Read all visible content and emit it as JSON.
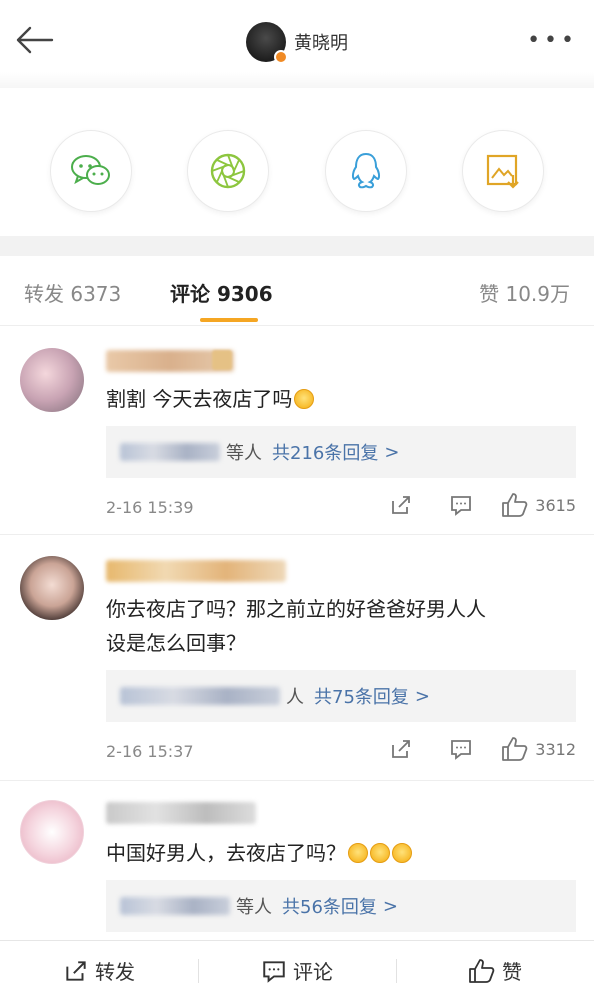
{
  "header": {
    "title": "黄晓明",
    "more_label": "•••"
  },
  "share": {
    "items": [
      {
        "icon": "wechat-icon"
      },
      {
        "icon": "moments-icon"
      },
      {
        "icon": "qq-icon"
      },
      {
        "icon": "save-image-icon"
      }
    ]
  },
  "tabs": {
    "repost": "转发 6373",
    "comment": "评论 9306",
    "like": "赞 10.9万"
  },
  "comments": [
    {
      "text": "割割 今天去夜店了吗",
      "replies_who": "等人",
      "replies_count": "共216条回复",
      "arrow": ">",
      "time": "2-16 15:39",
      "likes": "3615"
    },
    {
      "text_line1": "你去夜店了吗？那之前立的好爸爸好男人人",
      "text_line2": "设是怎么回事？",
      "replies_who": "人",
      "replies_count": "共75条回复",
      "arrow": ">",
      "time": "2-16 15:37",
      "likes": "3312"
    },
    {
      "text": "中国好男人，去夜店了吗？",
      "replies_who": "等人",
      "replies_count": "共56条回复",
      "arrow": ">"
    }
  ],
  "bottom_bar": {
    "repost": "转发",
    "comment": "评论",
    "like": "赞"
  },
  "colors": {
    "accent": "#f5a623",
    "link": "#4a73a8",
    "wechat": "#4cae4c"
  }
}
